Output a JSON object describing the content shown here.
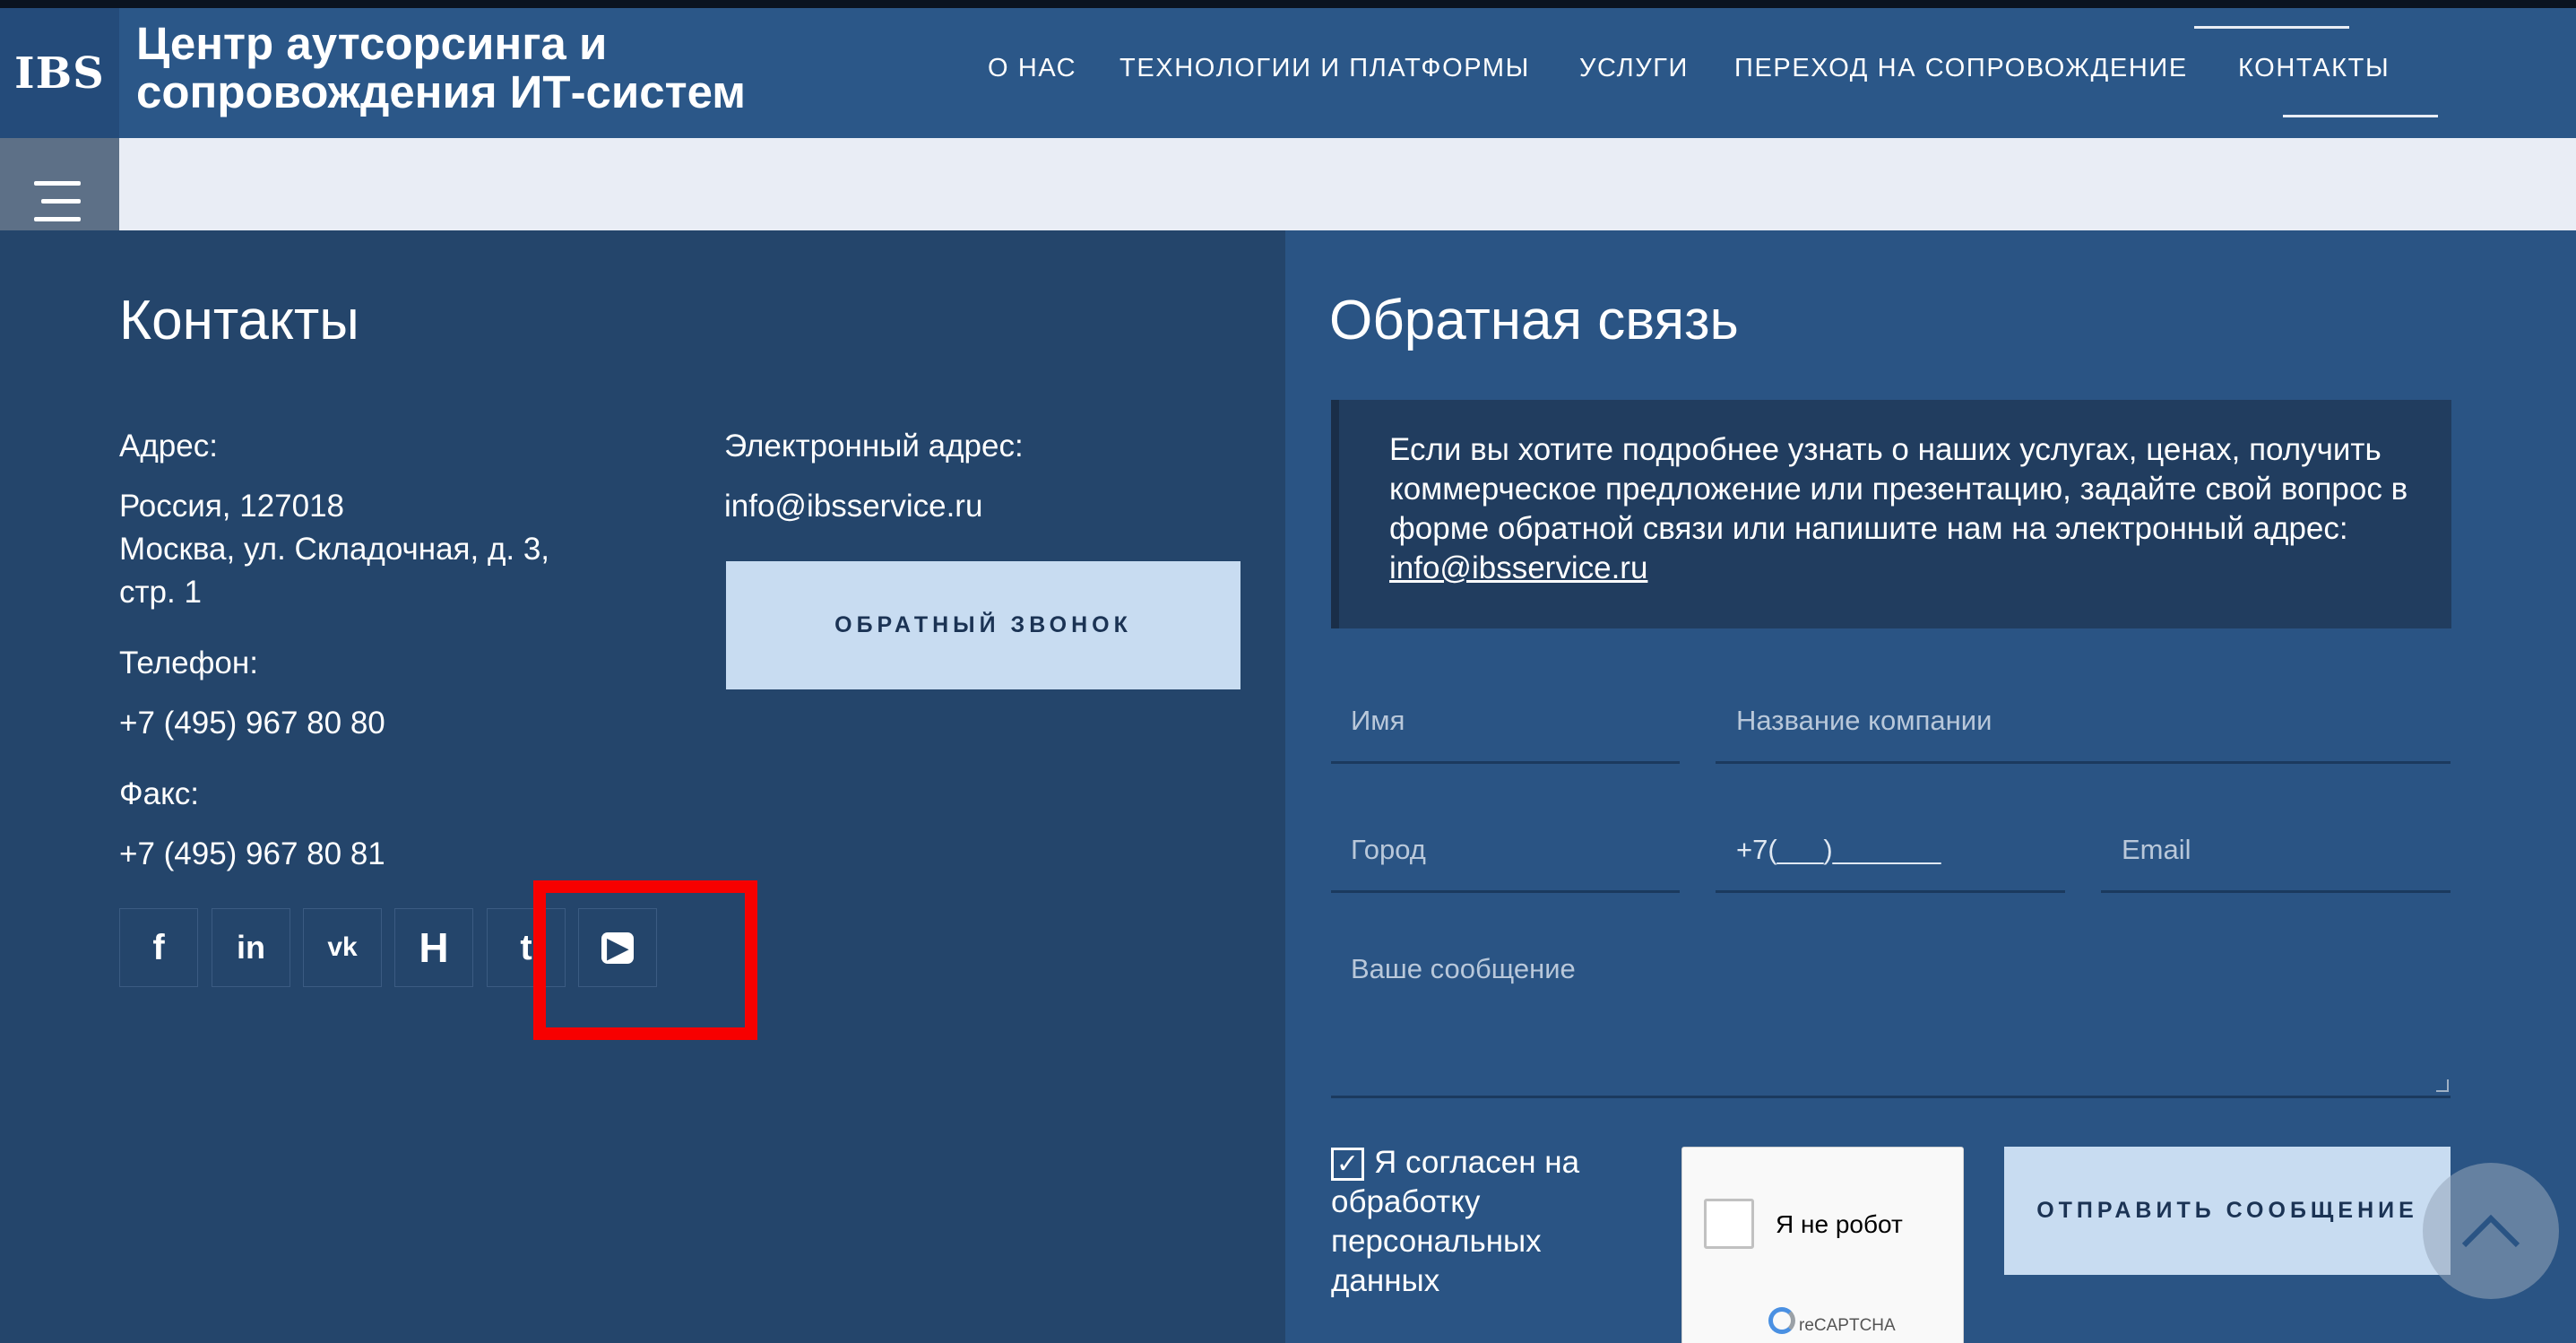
{
  "header": {
    "logo_text": "IBS",
    "site_title": "Центр аутсорсинга и сопровождения ИТ-систем",
    "nav": [
      {
        "label": "О НАС"
      },
      {
        "label": "ТЕХНОЛОГИИ И ПЛАТФОРМЫ"
      },
      {
        "label": "УСЛУГИ"
      },
      {
        "label": "ПЕРЕХОД НА СОПРОВОЖДЕНИЕ"
      },
      {
        "label": "КОНТАКТЫ"
      }
    ]
  },
  "contacts": {
    "title": "Контакты",
    "address_label": "Адрес:",
    "address_line1": "Россия, 127018",
    "address_line2": "Москва, ул. Складочная, д. 3,",
    "address_line3": "стр. 1",
    "phone_label": "Телефон:",
    "phone": "+7 (495) 967 80 80",
    "fax_label": "Факс:",
    "fax": "+7 (495) 967 80 81",
    "email_label": "Электронный адрес:",
    "email": "info@ibsservice.ru",
    "callback_button": "ОБРАТНЫЙ ЗВОНОК",
    "social": [
      {
        "icon": "facebook-icon",
        "glyph": "f"
      },
      {
        "icon": "linkedin-icon",
        "glyph": "in"
      },
      {
        "icon": "vk-icon",
        "glyph": "vk"
      },
      {
        "icon": "hh-icon",
        "glyph": "H"
      },
      {
        "icon": "twitter-icon",
        "glyph": "t"
      },
      {
        "icon": "youtube-icon",
        "glyph": "▶"
      }
    ]
  },
  "feedback": {
    "title": "Обратная связь",
    "info_text": "Если вы хотите подробнее узнать о наших услугах, ценах, получить коммерческое предложение или презентацию, задайте свой вопрос в форме обратной связи или напишите нам на электронный адрес: ",
    "info_email": "info@ibsservice.ru",
    "fields": {
      "name": "Имя",
      "company": "Название компании",
      "city": "Город",
      "phone": "+7(___)_______",
      "email": "Email",
      "message": "Ваше сообщение"
    },
    "agree": "Я согласен на обработку персональных данных",
    "agree_checked": true,
    "recaptcha_label": "Я не робот",
    "recaptcha_brand": "reCAPTCHA",
    "send_button": "ОТПРАВИТЬ СООБЩЕНИЕ"
  },
  "colors": {
    "header_bg": "#2b5788",
    "left_bg": "#24456b",
    "right_bg": "#2a5484",
    "button_bg": "#c8dcf1",
    "highlight": "#f70000"
  }
}
